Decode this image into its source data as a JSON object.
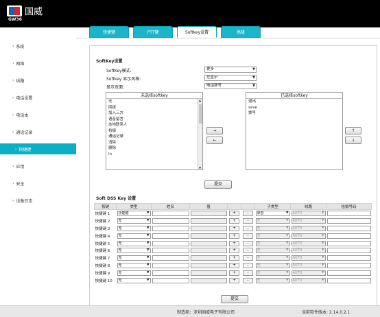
{
  "header": {
    "logo_text": "国威",
    "model": "GW36"
  },
  "sidebar": {
    "items": [
      {
        "label": "系统"
      },
      {
        "label": "网络"
      },
      {
        "label": "线路"
      },
      {
        "label": "电话设置"
      },
      {
        "label": "电话本"
      },
      {
        "label": "通话记录"
      },
      {
        "label": "快捷键"
      },
      {
        "label": "应用"
      },
      {
        "label": "安全"
      },
      {
        "label": "设备日志"
      }
    ],
    "active_index": 6
  },
  "tabs": [
    {
      "label": "快捷键"
    },
    {
      "label": "PTT键"
    },
    {
      "label": "Softkey设置"
    },
    {
      "label": "高级"
    }
  ],
  "softkey": {
    "title": "SoftKey设置",
    "mode_label": "SoftKey模式:",
    "mode_value": "更多",
    "style_label": "Softkey 显示风格:",
    "style_value": "左显示",
    "page_label": "显示页面:",
    "page_value": "电话拨号",
    "unselected_title": "未选择softkey",
    "unselected_items": [
      "无",
      "回拨",
      "加入三方",
      "语音留言",
      "本地联系人",
      "拾掇",
      "通话记录",
      "消除",
      "删除",
      "In"
    ],
    "selected_title": "已选择softkey",
    "selected_items": [
      "退出",
      "save",
      "拨号"
    ],
    "move_right": "→",
    "move_left": "←",
    "move_up": "↑",
    "move_down": "↓",
    "submit": "提交"
  },
  "dss": {
    "title": "Soft DSS Key 设置",
    "columns": [
      "按键",
      "类型",
      "姓名",
      "值",
      "",
      "",
      "子类型",
      "线路",
      "拾掇号码"
    ],
    "rows": [
      {
        "key": "快捷键 1",
        "type": "功能键",
        "subtype": "录音",
        "line": "AUTO",
        "sub_enabled": true
      },
      {
        "key": "快捷键 2",
        "type": "无",
        "subtype": "无",
        "line": "AUTO",
        "sub_enabled": false
      },
      {
        "key": "快捷键 3",
        "type": "无",
        "subtype": "无",
        "line": "AUTO",
        "sub_enabled": false
      },
      {
        "key": "快捷键 4",
        "type": "无",
        "subtype": "无",
        "line": "AUTO",
        "sub_enabled": false
      },
      {
        "key": "快捷键 5",
        "type": "无",
        "subtype": "无",
        "line": "AUTO",
        "sub_enabled": false
      },
      {
        "key": "快捷键 6",
        "type": "无",
        "subtype": "无",
        "line": "AUTO",
        "sub_enabled": false
      },
      {
        "key": "快捷键 7",
        "type": "无",
        "subtype": "无",
        "line": "AUTO",
        "sub_enabled": false
      },
      {
        "key": "快捷键 8",
        "type": "无",
        "subtype": "无",
        "line": "AUTO",
        "sub_enabled": false
      },
      {
        "key": "快捷键 9",
        "type": "无",
        "subtype": "无",
        "line": "AUTO",
        "sub_enabled": false
      },
      {
        "key": "快捷键 10",
        "type": "无",
        "subtype": "无",
        "line": "AUTO",
        "sub_enabled": false
      }
    ],
    "plus": "+",
    "minus": "-",
    "submit": "提交"
  },
  "footer": {
    "copyright": "制造商：深圳国威电子有限公司",
    "version": "当前软件版本: 2.14.0.2.1"
  },
  "colors": {
    "accent": "#0bb0c6",
    "header_bg": "#000000"
  }
}
